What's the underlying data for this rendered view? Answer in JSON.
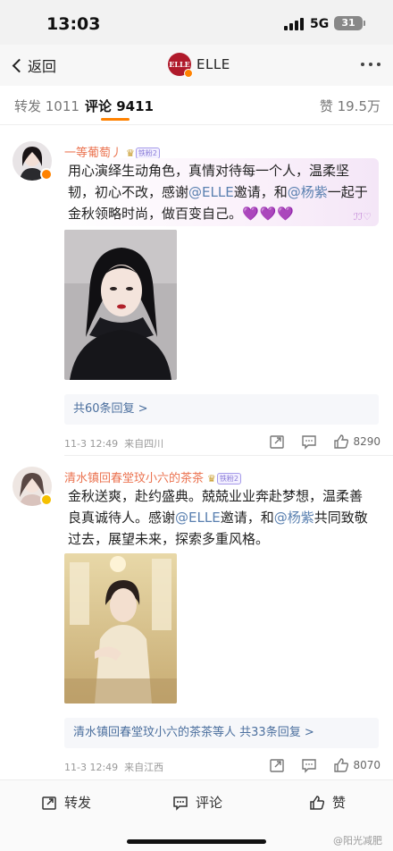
{
  "status_bar": {
    "time": "13:03",
    "network": "5G",
    "battery": "31"
  },
  "nav": {
    "back_label": "返回",
    "logo_text": "ELLE",
    "title": "ELLE"
  },
  "tabs": {
    "repost": "转发 1011",
    "comment": "评论 9411",
    "like": "赞 19.5万"
  },
  "comments": [
    {
      "username": "一等葡萄丿",
      "fan_badge": "铁粉2",
      "text_parts": [
        "用心演绎生动角色，真情对待每一个人，温柔坚韧，初心不改，感谢",
        "@ELLE",
        "邀请，和",
        "@杨紫",
        "一起于金秋领略时尚，做百变自己。",
        "💜💜💜"
      ],
      "reply_summary": "共60条回复 >",
      "time": "11-3 12:49",
      "location": "来自四川",
      "likes": "8290"
    },
    {
      "username": "清水镇回春堂玟小六的茶茶",
      "fan_badge": "铁粉2",
      "text_parts": [
        "金秋送爽，赴约盛典。兢兢业业奔赴梦想，温柔善良真诚待人。感谢",
        "@ELLE",
        "邀请，和",
        "@杨紫",
        "共同致敬过去，展望未来，探索多重风格。"
      ],
      "reply_user": "清水镇回春堂玟小六的茶茶",
      "reply_summary": "等人 共33条回复 >",
      "time": "11-3 12:49",
      "location": "来自江西",
      "likes": "8070"
    }
  ],
  "bottom_bar": {
    "repost": "转发",
    "comment": "评论",
    "like": "赞"
  },
  "watermark": "@阳光减肥",
  "colors": {
    "accent": "#ff8200",
    "username": "#eb7350",
    "link": "#5a80b0",
    "reply_link": "#4b6f9e",
    "hearts": "#9d3fe0"
  },
  "icons": [
    "back-chevron-icon",
    "elle-logo",
    "more-icon",
    "share-icon",
    "comment-icon",
    "like-icon",
    "crown-icon",
    "verified-icon"
  ]
}
